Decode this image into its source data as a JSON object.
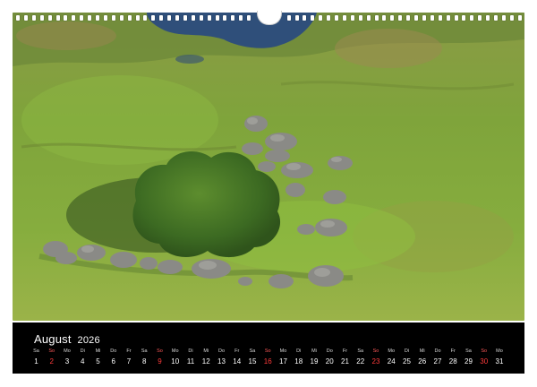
{
  "calendar": {
    "month": "August",
    "year": "2026",
    "days": [
      {
        "dow": "Sa",
        "num": "1",
        "weekend": false
      },
      {
        "dow": "So",
        "num": "2",
        "weekend": true
      },
      {
        "dow": "Mo",
        "num": "3",
        "weekend": false
      },
      {
        "dow": "Di",
        "num": "4",
        "weekend": false
      },
      {
        "dow": "Mi",
        "num": "5",
        "weekend": false
      },
      {
        "dow": "Do",
        "num": "6",
        "weekend": false
      },
      {
        "dow": "Fr",
        "num": "7",
        "weekend": false
      },
      {
        "dow": "Sa",
        "num": "8",
        "weekend": false
      },
      {
        "dow": "So",
        "num": "9",
        "weekend": true
      },
      {
        "dow": "Mo",
        "num": "10",
        "weekend": false
      },
      {
        "dow": "Di",
        "num": "11",
        "weekend": false
      },
      {
        "dow": "Mi",
        "num": "12",
        "weekend": false
      },
      {
        "dow": "Do",
        "num": "13",
        "weekend": false
      },
      {
        "dow": "Fr",
        "num": "14",
        "weekend": false
      },
      {
        "dow": "Sa",
        "num": "15",
        "weekend": false
      },
      {
        "dow": "So",
        "num": "16",
        "weekend": true
      },
      {
        "dow": "Mo",
        "num": "17",
        "weekend": false
      },
      {
        "dow": "Di",
        "num": "18",
        "weekend": false
      },
      {
        "dow": "Mi",
        "num": "19",
        "weekend": false
      },
      {
        "dow": "Do",
        "num": "20",
        "weekend": false
      },
      {
        "dow": "Fr",
        "num": "21",
        "weekend": false
      },
      {
        "dow": "Sa",
        "num": "22",
        "weekend": false
      },
      {
        "dow": "So",
        "num": "23",
        "weekend": true
      },
      {
        "dow": "Mo",
        "num": "24",
        "weekend": false
      },
      {
        "dow": "Di",
        "num": "25",
        "weekend": false
      },
      {
        "dow": "Mi",
        "num": "26",
        "weekend": false
      },
      {
        "dow": "Do",
        "num": "27",
        "weekend": false
      },
      {
        "dow": "Fr",
        "num": "28",
        "weekend": false
      },
      {
        "dow": "Sa",
        "num": "29",
        "weekend": false
      },
      {
        "dow": "So",
        "num": "30",
        "weekend": true
      },
      {
        "dow": "Mo",
        "num": "31",
        "weekend": false
      }
    ]
  },
  "colors": {
    "band": "#000000",
    "text": "#ffffff",
    "sunday": "#ff3b3b",
    "grass": "#7fa23a",
    "water": "#2f4f7a",
    "elephant": "#8a8a86"
  },
  "photo": {
    "icons": [
      "spiral-binding-icon",
      "hanger-hole-icon"
    ]
  }
}
